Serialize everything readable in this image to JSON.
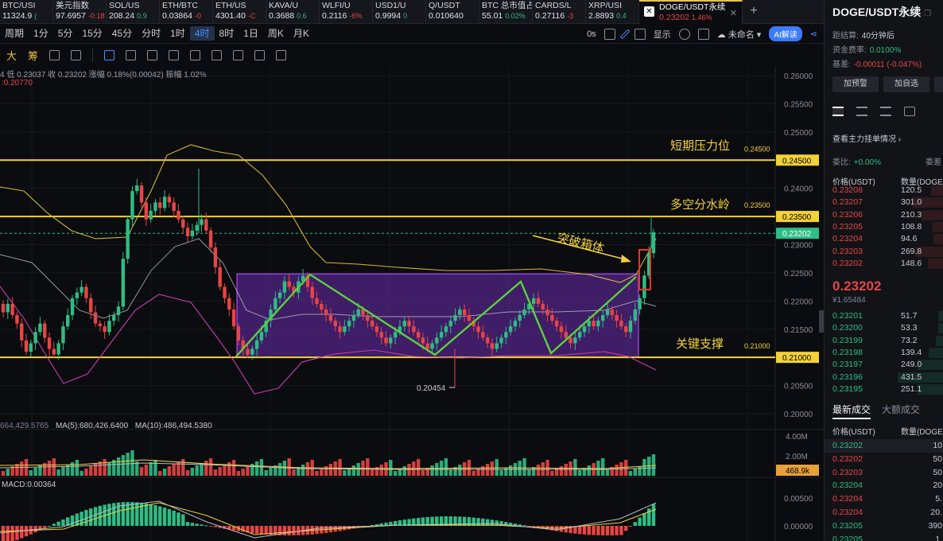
{
  "tickers": [
    {
      "name": "BTC/USI",
      "price": "11324.9",
      "change": "(",
      "dir": "up"
    },
    {
      "name": "美元指数",
      "price": "97.6957",
      "change": "-0.18",
      "dir": "dn"
    },
    {
      "name": "SOL/US",
      "price": "208.24",
      "change": "0.9",
      "dir": "up"
    },
    {
      "name": "ETH/BTC",
      "price": "0.03864",
      "change": "-0",
      "dir": "dn"
    },
    {
      "name": "ETH/US",
      "price": "4301.40",
      "change": "-C",
      "dir": "dn"
    },
    {
      "name": "KAVA/U",
      "price": "0.3688",
      "change": "0.6",
      "dir": "up"
    },
    {
      "name": "WLFI/U",
      "price": "0.2116",
      "change": "-6%",
      "dir": "dn"
    },
    {
      "name": "USD1/U",
      "price": "0.9994",
      "change": "0",
      "dir": "up"
    },
    {
      "name": "Q/USDT",
      "price": "0.010640",
      "change": "",
      "dir": "dn"
    },
    {
      "name": "BTC 总市值占",
      "price": "55.01",
      "change": "0.02%",
      "dir": "up"
    },
    {
      "name": "CARDS/L",
      "price": "0.27116",
      "change": "-3",
      "dir": "dn"
    },
    {
      "name": "XRP/USI",
      "price": "2.8893",
      "change": "0.4",
      "dir": "up"
    }
  ],
  "active_tab": {
    "name": "DOGE/USDT永续",
    "price": "0.23202",
    "change": "1.46%"
  },
  "intervals": [
    "周期",
    "1分",
    "5分",
    "15分",
    "45分",
    "分时",
    "1时",
    "4时",
    "8时",
    "1日",
    "周K",
    "月K"
  ],
  "active_interval": "4时",
  "toolbar": {
    "timer": "0s",
    "display": "显示",
    "unnamed": "未命名",
    "ai": "AI解读"
  },
  "drawbar": {
    "big": "大",
    "chip": "筹"
  },
  "legend": {
    "line1": "4  低 0.23037  收 0.23202  涨幅 0.18%(0.00042)  振幅 1.02%",
    "line2": ":0.20770",
    "vol": "664,429.5765",
    "ma5": "MA(5):680,426.6400",
    "ma10": "MA(10):486,494.5380",
    "macd": "MACD:0.00364"
  },
  "annotations": {
    "resistance": "短期压力位",
    "watershed": "多空分水岭",
    "breakout": "突破箱体",
    "support": "关键支撑",
    "low_marker": "0.20454"
  },
  "levels": {
    "resistance": "0.24500",
    "watershed": "0.23500",
    "support": "0.21000",
    "current": "0.23202",
    "vol_current": "468.9k"
  },
  "price_axis": [
    "0.26000",
    "0.25500",
    "0.25000",
    "0.24500",
    "0.24000",
    "0.23500",
    "0.23000",
    "0.22500",
    "0.22000",
    "0.21500",
    "0.21000",
    "0.20500",
    "0.20000"
  ],
  "vol_axis": [
    "4.00M",
    "2.00M"
  ],
  "macd_axis": [
    "0.00500",
    "0.00000"
  ],
  "colors": {
    "up": "#2ebd85",
    "down": "#e84545",
    "level": "#f2d23b",
    "box": "#6b2bb0",
    "zigzag": "#5cd13b"
  },
  "right_panel": {
    "title": "DOGE/USDT永续",
    "settle_label": "距结算:",
    "settle_value": "40分钟后",
    "funding_label": "资金费率:",
    "funding_value": "0.0100%",
    "basis_label": "基差:",
    "basis_value": "-0.00011 (-0.047%)",
    "btn_alert": "加预警",
    "btn_fav": "加自选",
    "orders_title": "查看主力挂单情况",
    "ratio_label": "委比:",
    "ratio_value": "+0.00%",
    "ratio_right": "委差",
    "ob_price_head": "价格(USDT)",
    "ob_qty_head": "数量(DOGE",
    "asks": [
      {
        "p": "0.23208",
        "q": "120.5"
      },
      {
        "p": "0.23207",
        "q": "301.0"
      },
      {
        "p": "0.23206",
        "q": "210.3"
      },
      {
        "p": "0.23205",
        "q": "108.8"
      },
      {
        "p": "0.23204",
        "q": "94.6"
      },
      {
        "p": "0.23203",
        "q": "269.8"
      },
      {
        "p": "0.23202",
        "q": "148.6"
      }
    ],
    "mid_price": "0.23202",
    "mid_sub": "¥1.65484",
    "bids": [
      {
        "p": "0.23201",
        "q": "51.7"
      },
      {
        "p": "0.23200",
        "q": "53.3"
      },
      {
        "p": "0.23199",
        "q": "73.2"
      },
      {
        "p": "0.23198",
        "q": "139.4"
      },
      {
        "p": "0.23197",
        "q": "249.0"
      },
      {
        "p": "0.23196",
        "q": "431.5"
      },
      {
        "p": "0.23195",
        "q": "251.1"
      }
    ],
    "trades_tab1": "最新成交",
    "trades_tab2": "大额成交",
    "tr_price_head": "价格(USDT)",
    "tr_qty_head": "数量(DOGE",
    "trades": [
      {
        "p": "0.23202",
        "q": "10",
        "d": "g"
      },
      {
        "p": "0.23202",
        "q": "50",
        "d": "r"
      },
      {
        "p": "0.23203",
        "q": "50",
        "d": "r"
      },
      {
        "p": "0.23204",
        "q": "20",
        "d": "g"
      },
      {
        "p": "0.23204",
        "q": "5.",
        "d": "r"
      },
      {
        "p": "0.23204",
        "q": "20.",
        "d": "r"
      },
      {
        "p": "0.23205",
        "q": "390",
        "d": "g"
      },
      {
        "p": "0.23205",
        "q": "1.",
        "d": "g"
      }
    ]
  }
}
